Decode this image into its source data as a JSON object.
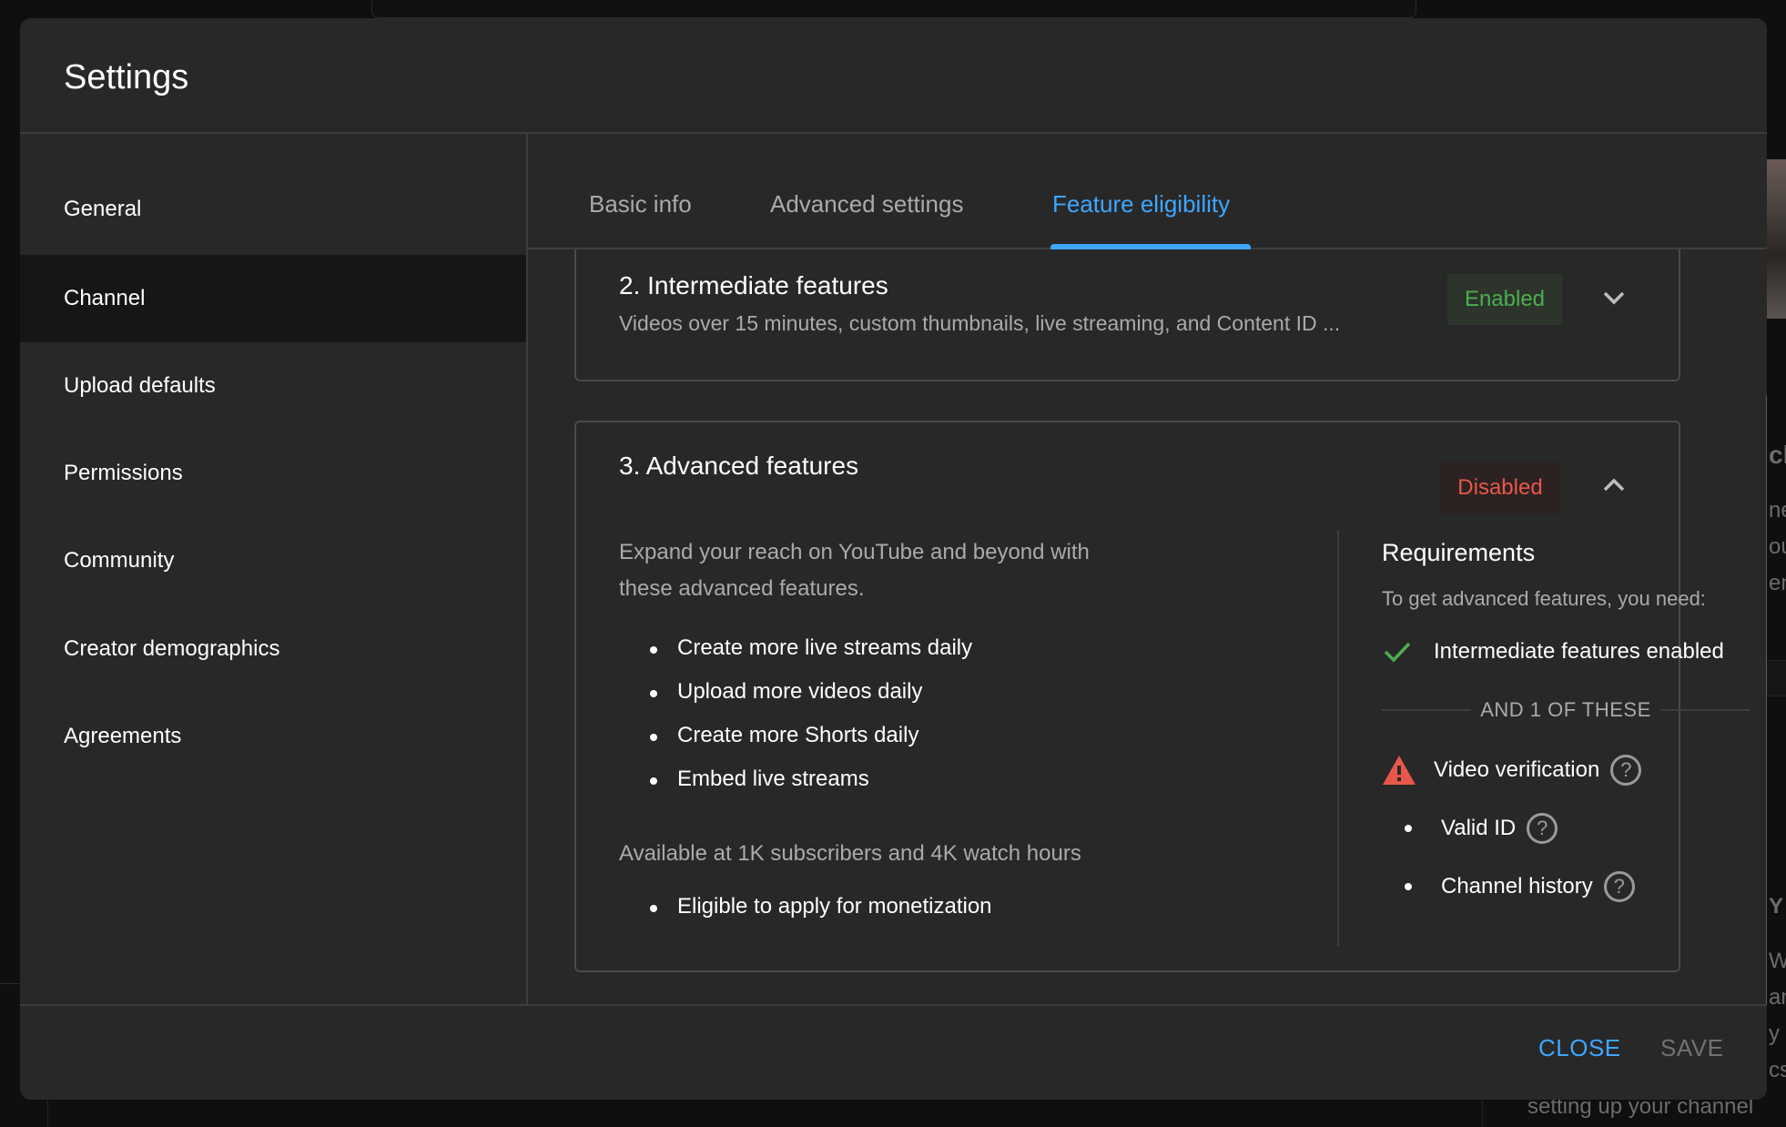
{
  "background": {
    "right_text_fragments": [
      "ck",
      "ne",
      "ou",
      "en",
      "Y",
      "We",
      "an",
      "y",
      "cs"
    ],
    "bottom_text": "setting up your channel"
  },
  "modal": {
    "title": "Settings"
  },
  "sidebar": {
    "items": [
      {
        "label": "General",
        "active": false
      },
      {
        "label": "Channel",
        "active": true
      },
      {
        "label": "Upload defaults",
        "active": false
      },
      {
        "label": "Permissions",
        "active": false
      },
      {
        "label": "Community",
        "active": false
      },
      {
        "label": "Creator demographics",
        "active": false
      },
      {
        "label": "Agreements",
        "active": false
      }
    ]
  },
  "tabs": [
    {
      "label": "Basic info",
      "active": false
    },
    {
      "label": "Advanced settings",
      "active": false
    },
    {
      "label": "Feature eligibility",
      "active": true
    }
  ],
  "cards": {
    "intermediate": {
      "title": "2. Intermediate features",
      "subtitle": "Videos over 15 minutes, custom thumbnails, live streaming, and Content ID ...",
      "status": "Enabled",
      "expanded": false,
      "chevron_icon": "chevron-down-icon"
    },
    "advanced": {
      "title": "3. Advanced features",
      "status": "Disabled",
      "expanded": true,
      "chevron_icon": "chevron-up-icon",
      "description": "Expand your reach on YouTube and beyond with these advanced features.",
      "features": [
        "Create more live streams daily",
        "Upload more videos daily",
        "Create more Shorts daily",
        "Embed live streams"
      ],
      "availability_note": "Available at 1K subscribers and 4K watch hours",
      "availability_features": [
        "Eligible to apply for monetization"
      ],
      "requirements": {
        "title": "Requirements",
        "subtitle": "To get advanced features, you need:",
        "met": {
          "label": "Intermediate features enabled",
          "icon": "check-icon"
        },
        "separator": "AND 1 OF THESE",
        "options": [
          {
            "label": "Video verification",
            "icon": "warning-icon",
            "help": "?"
          },
          {
            "label": "Valid ID",
            "icon": "bullet",
            "help": "?"
          },
          {
            "label": "Channel history",
            "icon": "bullet",
            "help": "?"
          }
        ]
      }
    }
  },
  "footer": {
    "close_label": "CLOSE",
    "save_label": "SAVE"
  },
  "colors": {
    "accent": "#3ea6ff",
    "enabled": "#4caf50",
    "disabled": "#e8574a",
    "surface": "#282828"
  }
}
